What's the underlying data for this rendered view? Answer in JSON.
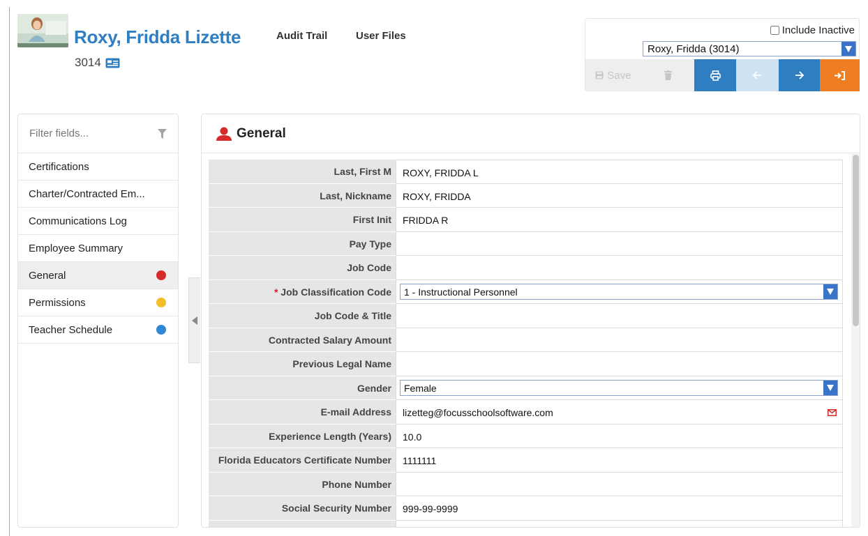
{
  "header": {
    "name": "Roxy, Fridda Lizette",
    "staff_id": "3014",
    "links": {
      "audit_trail": "Audit Trail",
      "user_files": "User Files"
    }
  },
  "controls": {
    "include_inactive": "Include Inactive",
    "include_inactive_checked": false,
    "staff_select": "Roxy, Fridda (3014)",
    "save_label": "Save",
    "icons": [
      "save-icon",
      "trash-icon",
      "print-icon",
      "arrow-left-icon",
      "arrow-right-icon",
      "exit-icon"
    ],
    "colors": {
      "primary": "#2f7ec1",
      "disabled_blue": "#cfe2f3",
      "exit": "#ef7d22"
    }
  },
  "sidebar": {
    "filter_placeholder": "Filter fields...",
    "items": [
      {
        "label": "Certifications",
        "dot": null
      },
      {
        "label": "Charter/Contracted Em...",
        "dot": null
      },
      {
        "label": "Communications Log",
        "dot": null
      },
      {
        "label": "Employee Summary",
        "dot": null
      },
      {
        "label": "General",
        "dot": "#d62b2b",
        "active": true
      },
      {
        "label": "Permissions",
        "dot": "#f2bf2a"
      },
      {
        "label": "Teacher Schedule",
        "dot": "#2f86d4"
      }
    ]
  },
  "panel": {
    "title": "General",
    "fields": [
      {
        "label": "Last, First M",
        "value": "ROXY, FRIDDA L"
      },
      {
        "label": "Last, Nickname",
        "value": "ROXY, FRIDDA"
      },
      {
        "label": "First Init",
        "value": "FRIDDA R"
      },
      {
        "label": "Pay Type",
        "value": ""
      },
      {
        "label": "Job Code",
        "value": ""
      },
      {
        "label": "Job Classification Code",
        "value": "1 - Instructional Personnel",
        "required": true,
        "type": "select"
      },
      {
        "label": "Job Code & Title",
        "value": ""
      },
      {
        "label": "Contracted Salary Amount",
        "value": ""
      },
      {
        "label": "Previous Legal Name",
        "value": ""
      },
      {
        "label": "Gender",
        "value": "Female",
        "type": "select"
      },
      {
        "label": "E-mail Address",
        "value": "lizetteg@focusschoolsoftware.com",
        "type": "email"
      },
      {
        "label": "Experience Length (Years)",
        "value": "10.0"
      },
      {
        "label": "Florida Educators Certificate Number",
        "value": "1111111"
      },
      {
        "label": "Phone Number",
        "value": ""
      },
      {
        "label": "Social Security Number",
        "value": "999-99-9999"
      },
      {
        "label": "",
        "value": ""
      }
    ]
  }
}
